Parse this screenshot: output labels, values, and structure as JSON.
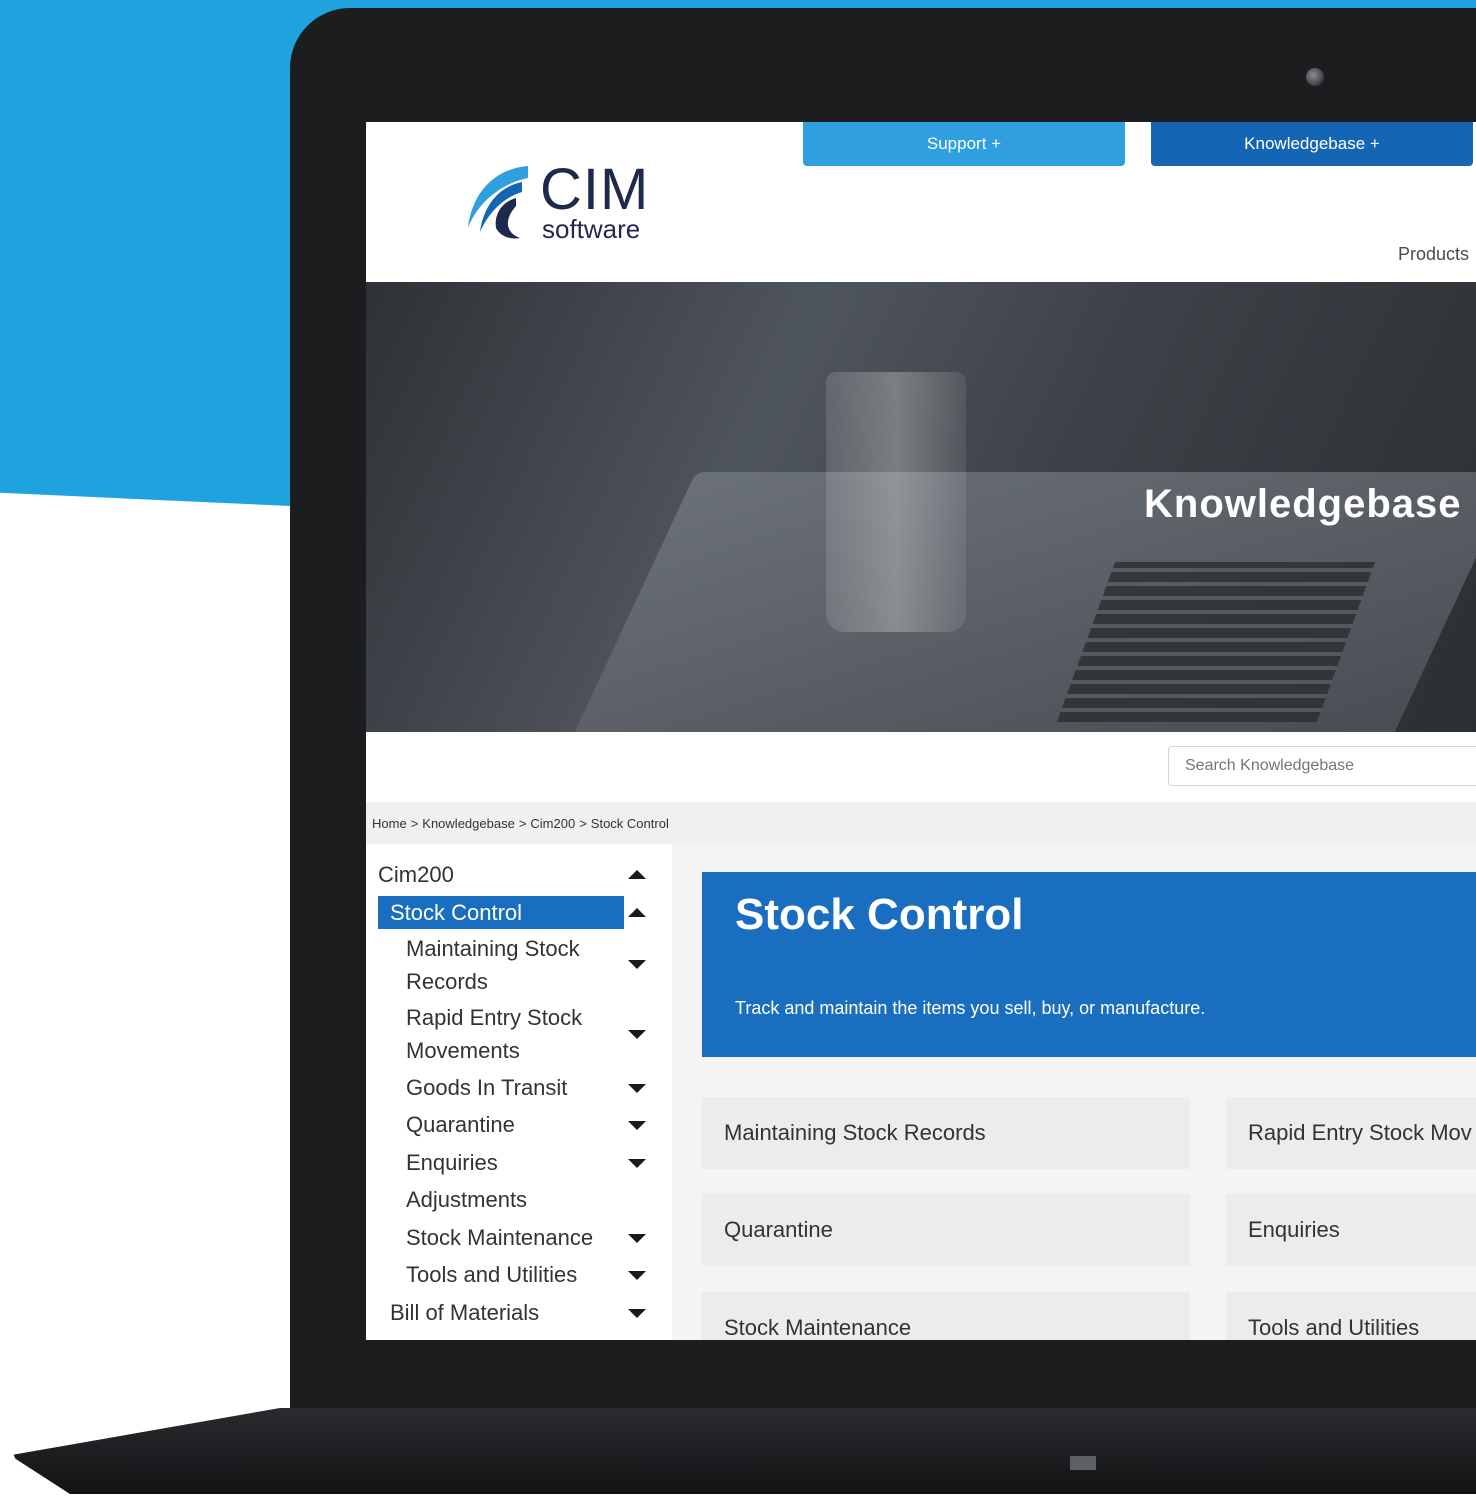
{
  "header": {
    "logo_main": "CIM",
    "logo_sub": "software",
    "support_label": "Support +",
    "knowledgebase_label": "Knowledgebase +",
    "products_label": "Products"
  },
  "hero": {
    "title": "Knowledgebase"
  },
  "search": {
    "placeholder": "Search Knowledgebase"
  },
  "breadcrumb": [
    "Home",
    ">",
    "Knowledgebase",
    ">",
    "Cim200",
    ">",
    "Stock Control"
  ],
  "sidebar": {
    "items": [
      {
        "label": "Cim200"
      },
      {
        "label": "Stock Control"
      },
      {
        "label": "Maintaining Stock Records"
      },
      {
        "label": "Rapid Entry Stock Movements"
      },
      {
        "label": "Goods In Transit"
      },
      {
        "label": "Quarantine"
      },
      {
        "label": "Enquiries"
      },
      {
        "label": "Adjustments"
      },
      {
        "label": "Stock Maintenance"
      },
      {
        "label": "Tools and Utilities"
      },
      {
        "label": "Bill of Materials"
      }
    ]
  },
  "main": {
    "title": "Stock Control",
    "description": "Track and maintain the items you sell, buy, or manufacture.",
    "cards": [
      {
        "label": "Maintaining Stock Records"
      },
      {
        "label": "Rapid Entry Stock Mov"
      },
      {
        "label": "Quarantine"
      },
      {
        "label": "Enquiries"
      },
      {
        "label": "Stock Maintenance"
      },
      {
        "label": "Tools and Utilities"
      }
    ]
  },
  "colors": {
    "brand_blue": "#1a6ec0",
    "light_blue": "#2f9fe0",
    "background_blue": "#1fa3df"
  }
}
